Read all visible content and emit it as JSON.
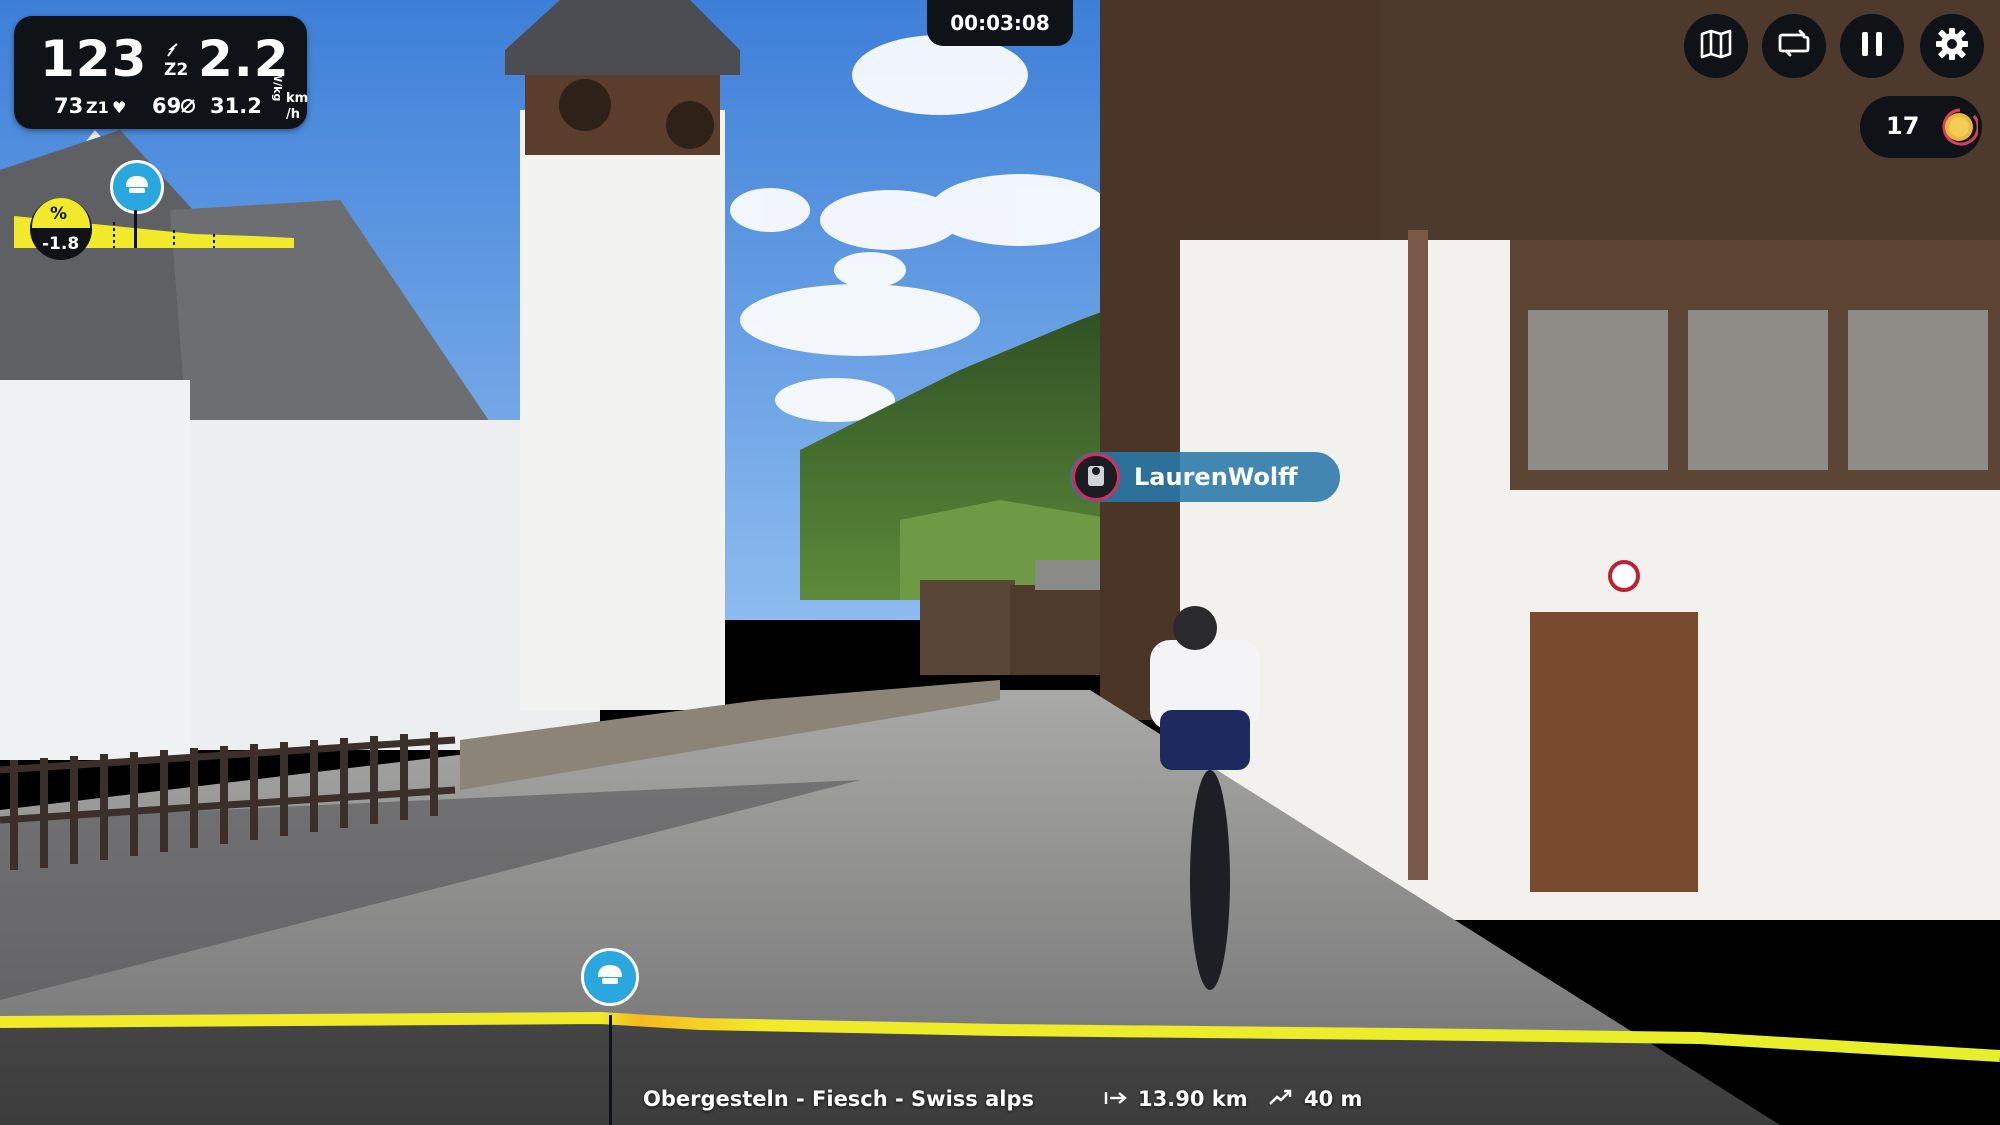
{
  "hud": {
    "power": "123",
    "power_zone": "Z2",
    "wkg": "2.2",
    "wkg_unit": "W/kg",
    "heart_rate": "73",
    "hr_zone": "Z1",
    "cadence": "69",
    "speed": "31.2",
    "speed_unit_top": "km",
    "speed_unit_bottom": "/h"
  },
  "timer": "00:03:08",
  "toolbar": {
    "icons": [
      "map-icon",
      "loop-icon",
      "pause-icon",
      "gear-icon"
    ]
  },
  "coins": {
    "count": "17"
  },
  "grade": {
    "symbol": "%",
    "value": "-1.8"
  },
  "rider": {
    "name": "LaurenWolff"
  },
  "route": {
    "name": "Obergesteln - Fiesch - Swiss alps",
    "distance": "13.90 km",
    "elevation": "40 m",
    "progress_fraction": 0.305
  },
  "colors": {
    "accent": "#f0ea2a",
    "panel": "#0f1216",
    "pin": "#2aa7de",
    "tag": "#2878aa"
  }
}
